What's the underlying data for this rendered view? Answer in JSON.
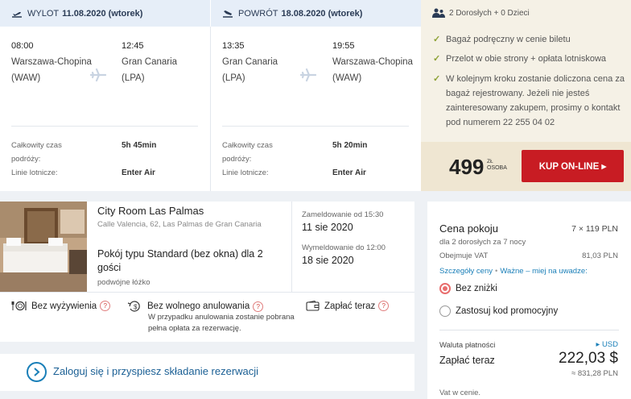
{
  "outbound": {
    "label": "WYLOT",
    "date": "11.08.2020 (wtorek)",
    "dep_time": "08:00",
    "arr_time": "12:45",
    "dep_city": "Warszawa-Chopina",
    "dep_code": "(WAW)",
    "arr_city": "Gran Canaria",
    "arr_code": "(LPA)",
    "duration_label": "Całkowity czas podróży:",
    "duration": "5h 45min",
    "airline_label": "Linie lotnicze:",
    "airline": "Enter Air"
  },
  "return": {
    "label": "POWRÓT",
    "date": "18.08.2020 (wtorek)",
    "dep_time": "13:35",
    "arr_time": "19:55",
    "dep_city": "Gran Canaria",
    "dep_code": "(LPA)",
    "arr_city": "Warszawa-Chopina",
    "arr_code": "(WAW)",
    "duration_label": "Całkowity czas podróży:",
    "duration": "5h 20min",
    "airline_label": "Linie lotnicze:",
    "airline": "Enter Air"
  },
  "info": {
    "passengers": "2 Dorosłych + 0 Dzieci",
    "checks": [
      "Bagaż podręczny w cenie biletu",
      "Przelot w obie strony + opłata lotniskowa",
      "W kolejnym kroku zostanie doliczona cena za bagaż rejestrowany. Jeżeli nie jesteś zainteresowany zakupem, prosimy o kontakt pod numerem 22 255 04 02"
    ],
    "price": "499",
    "currency": "ZŁ",
    "per": "OSOBA",
    "buy_label": "KUP ON-LINE ▸"
  },
  "hotel": {
    "name": "City Room Las Palmas",
    "address": "Calle Valencia, 62, Las Palmas de Gran Canaria",
    "room": "Pokój typu Standard (bez okna) dla 2 gości",
    "bed": "podwójne łóżko",
    "checkin_label": "Zameldowanie od 15:30",
    "checkin_date": "11 sie 2020",
    "checkout_label": "Wymeldowanie do 12:00",
    "checkout_date": "18 sie 2020",
    "meal": "Bez wyżywienia",
    "cancel": "Bez wolnego anulowania",
    "cancel_note": "W przypadku anulowania zostanie pobrana pełna opłata za rezerwację.",
    "pay": "Zapłać teraz",
    "help": "?"
  },
  "login": {
    "text": "Zaloguj się i przyspiesz składanie rezerwacji"
  },
  "summary": {
    "title": "Cena pokoju",
    "nights_price": "7 × 119 PLN",
    "guests": "dla 2 dorosłych  za 7 nocy",
    "vat_label": "Obejmuje VAT",
    "vat_value": "81,03 PLN",
    "link_details": "Szczegóły ceny",
    "link_sep": "•",
    "link_notes": "Ważne – miej na uwadze:",
    "radio_no_discount": "Bez zniżki",
    "radio_promo": "Zastosuj kod promocyjny",
    "currency_label": "Waluta płatności",
    "currency_switch": "▸ USD",
    "pay_now": "Zapłać teraz",
    "total": "222,03 $",
    "total_pln": "≈ 831,28 PLN",
    "vat_note": "Vat w cenie."
  }
}
